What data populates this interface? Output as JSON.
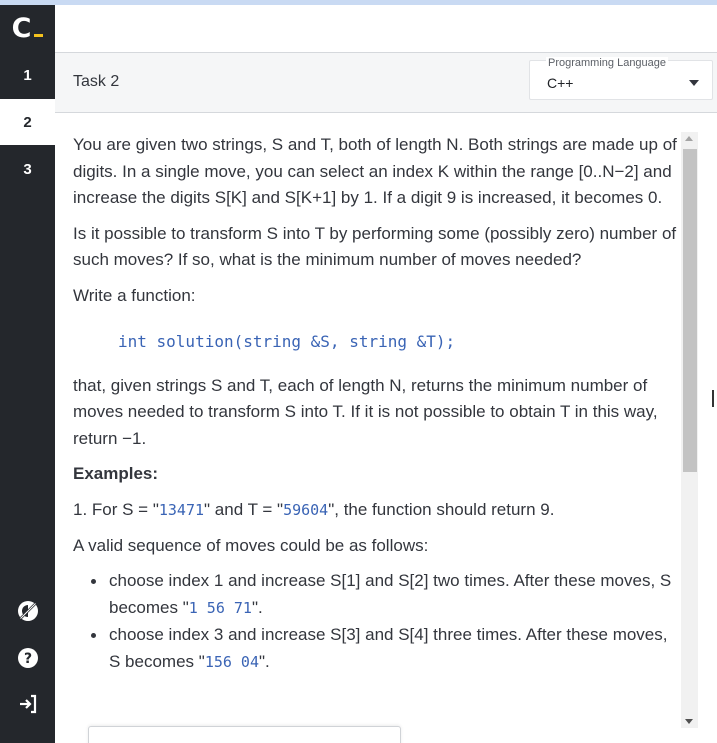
{
  "app": {
    "logo_letter": "C",
    "accent_color": "#f4c21e"
  },
  "sidebar": {
    "tasks": [
      {
        "label": "1",
        "active": false
      },
      {
        "label": "2",
        "active": true
      },
      {
        "label": "3",
        "active": false
      }
    ],
    "icons": [
      "theme-toggle-icon",
      "help-icon",
      "exit-icon"
    ]
  },
  "header": {
    "task_title": "Task 2",
    "language": {
      "label": "Programming Language",
      "value": "C++"
    }
  },
  "content": {
    "para1": "You are given two strings, S and T, both of length N. Both strings are made up of digits. In a single move, you can select an index K within the range [0..N−2] and increase the digits S[K] and S[K+1] by 1. If a digit 9 is increased, it becomes 0.",
    "para2": "Is it possible to transform S into T by performing some (possibly zero) number of such moves? If so, what is the minimum number of moves needed?",
    "para3": "Write a function:",
    "code": "int solution(string &S, string &T);",
    "para4": "that, given strings S and T, each of length N, returns the minimum number of moves needed to transform S into T. If it is not possible to obtain T in this way, return −1.",
    "examples_heading": "Examples:",
    "example1": {
      "prefix": "1. For S = \"",
      "s_value": "13471",
      "middle": "\" and T = \"",
      "t_value": "59604",
      "suffix": "\", the function should return 9."
    },
    "valid_sequence": "A valid sequence of moves could be as follows:",
    "moves": [
      {
        "text": "choose index 1 and increase S[1] and S[2] two times. After these moves, S becomes \"",
        "value": "1 56 71",
        "end": "\"."
      },
      {
        "text": "choose index 3 and increase S[3] and S[4] three times. After these moves, S becomes \"",
        "value": "156 04",
        "end": "\"."
      }
    ]
  }
}
